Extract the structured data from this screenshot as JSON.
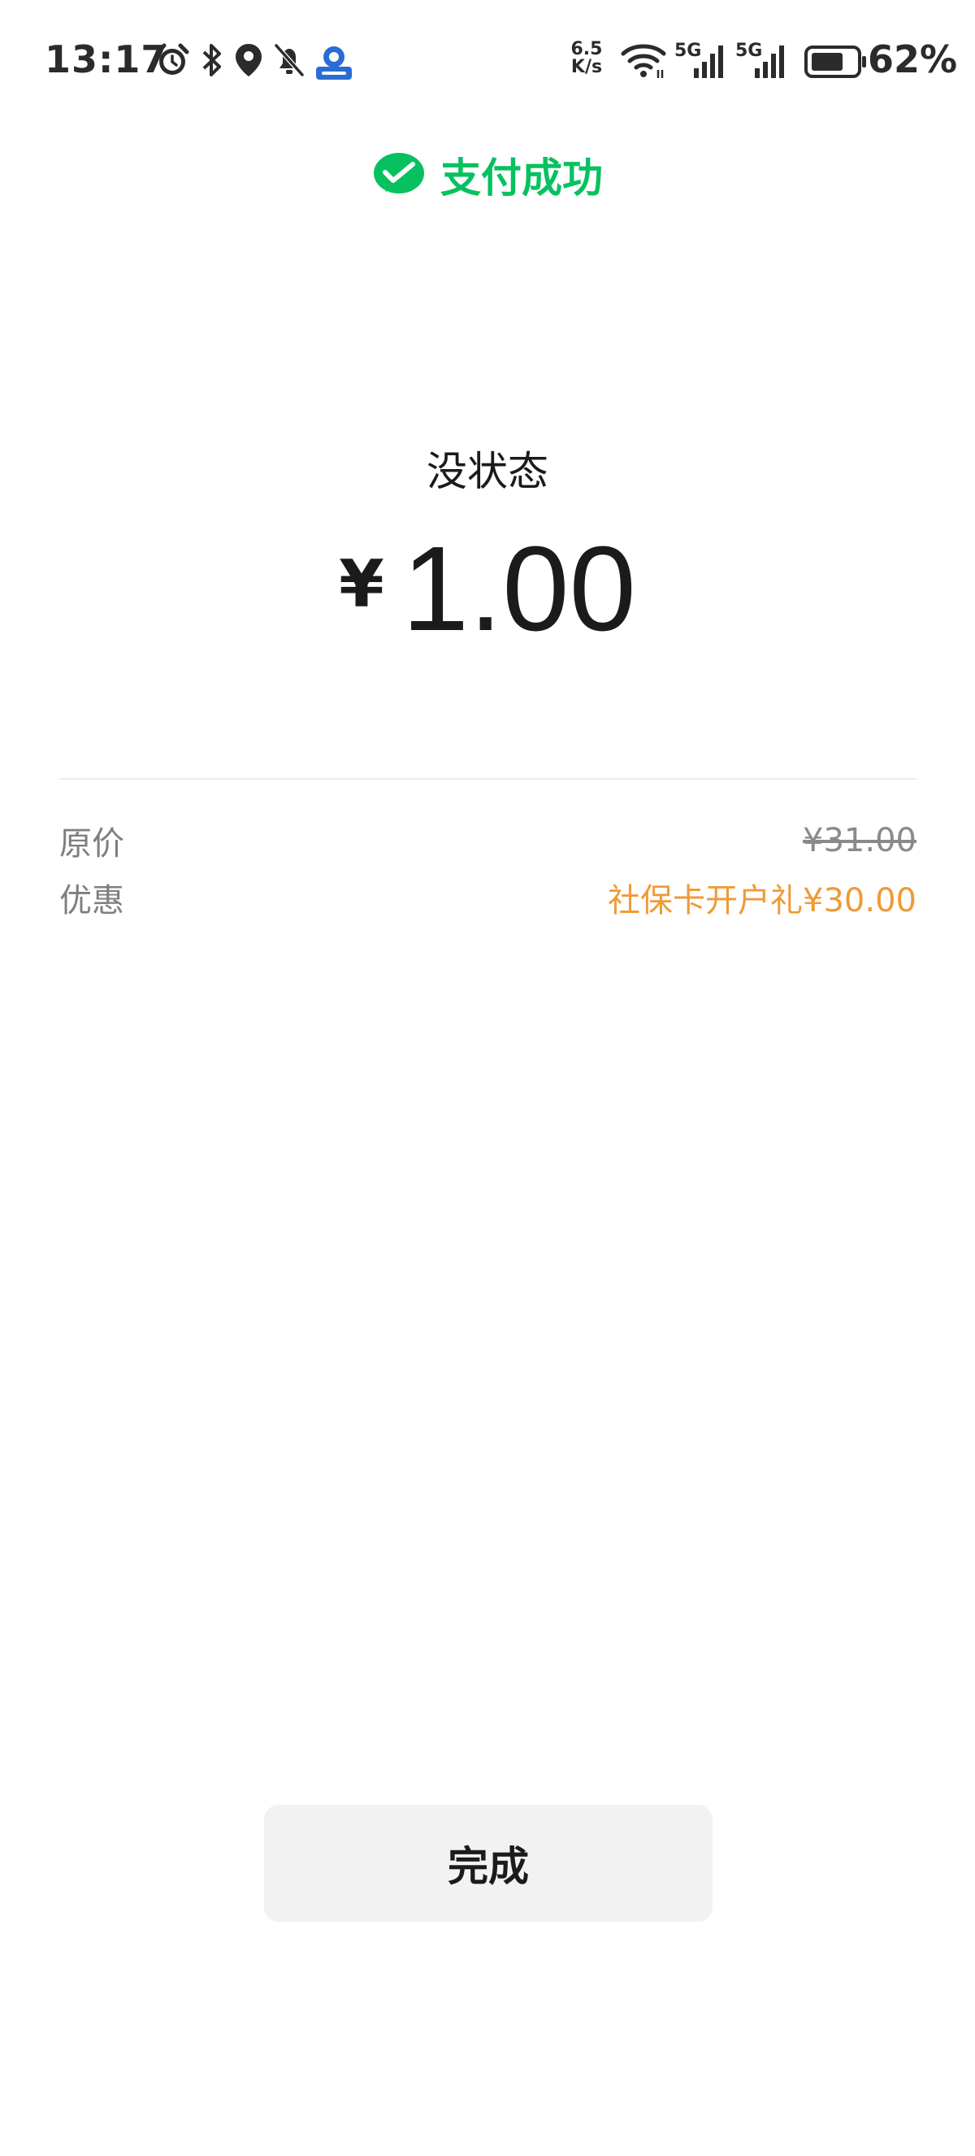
{
  "status_bar": {
    "time": "13:17",
    "net_speed_value": "6.5",
    "net_speed_unit": "K/s",
    "signal_label_1": "5G",
    "signal_label_2": "5G",
    "battery_percent": "62%",
    "icons": [
      "alarm-icon",
      "bluetooth-icon",
      "location-icon",
      "mute-bell-icon",
      "app-notification-icon",
      "wifi-icon",
      "signal-icon",
      "battery-icon"
    ]
  },
  "header": {
    "title": "支付成功",
    "icon": "wechat-pay-icon",
    "accent_color": "#07c160"
  },
  "payment": {
    "merchant": "没状态",
    "currency_symbol": "¥",
    "amount": "1.00"
  },
  "details": [
    {
      "label": "原价",
      "value": "¥31.00"
    },
    {
      "label": "优惠",
      "value": "社保卡开户礼¥30.00"
    }
  ],
  "colors": {
    "discount": "#f09a37",
    "muted": "#7f7f7f"
  },
  "actions": {
    "done_label": "完成"
  }
}
